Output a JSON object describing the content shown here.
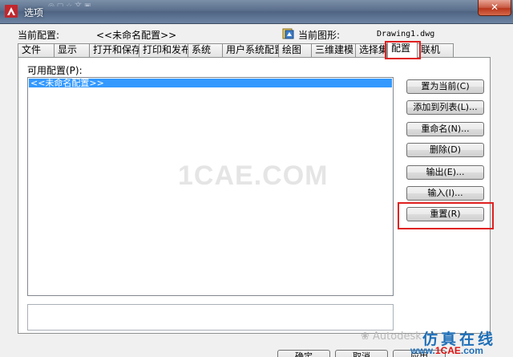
{
  "window": {
    "title": "选项",
    "close_label": "✕",
    "ghost_toolbar": "◎ ▢ ☆ 文 ▣"
  },
  "info": {
    "profile_label": "当前配置:",
    "profile_value": "<<未命名配置>>",
    "drawing_label": "当前图形:",
    "drawing_value": "Drawing1.dwg"
  },
  "tabs": [
    {
      "label": "文件"
    },
    {
      "label": "显示"
    },
    {
      "label": "打开和保存"
    },
    {
      "label": "打印和发布"
    },
    {
      "label": "系统"
    },
    {
      "label": "用户系统配置"
    },
    {
      "label": "绘图"
    },
    {
      "label": "三维建模"
    },
    {
      "label": "选择集"
    },
    {
      "label": "配置",
      "active": true
    },
    {
      "label": "联机"
    }
  ],
  "profiles": {
    "label": "可用配置(P):",
    "items": [
      "<<未命名配置>>"
    ],
    "selected_index": 0
  },
  "buttons": {
    "set_current": "置为当前(C)",
    "add_to_list": "添加到列表(L)...",
    "rename": "重命名(N)...",
    "delete": "删除(D)",
    "export": "输出(E)...",
    "import": "输入(I)...",
    "reset": "重置(R)"
  },
  "bottom_buttons": {
    "ok": "确定",
    "cancel": "取消",
    "apply": "应用"
  },
  "watermark": "1CAE.COM",
  "overlay": {
    "wechat": "❀ Autodesk",
    "brand_cn": "仿真在线",
    "brand_url_prefix": "www.",
    "brand_url_mid": "1CAE",
    "brand_url_suffix": ".com"
  },
  "colors": {
    "selection": "#3399ff",
    "highlight_box": "#e02020",
    "brand": "#1f6fb8"
  }
}
